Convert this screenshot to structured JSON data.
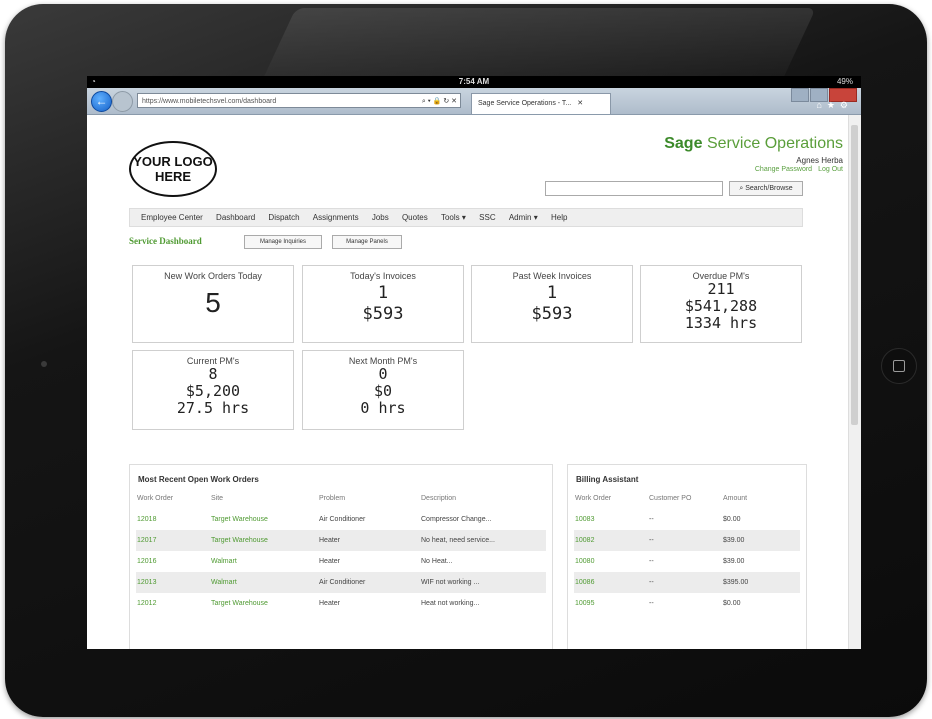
{
  "status": {
    "time": "7:54 AM",
    "battery": "49%"
  },
  "browser": {
    "url": "https://www.mobiletechsvel.com/dashboard",
    "url_controls": "⌕ ▾ 🔒 ↻ ✕",
    "tab_title": "Sage Service Operations - T...",
    "tab_close": "✕"
  },
  "app": {
    "logo": "YOUR LOGO HERE",
    "brand_bold": "Sage",
    "brand_rest": "Service Operations",
    "user_name": "Agnes Herba",
    "change_password": "Change Password",
    "log_out": "Log Out",
    "search_placeholder": "",
    "search_button": "⌕ Search/Browse"
  },
  "menu": [
    "Employee Center",
    "Dashboard",
    "Dispatch",
    "Assignments",
    "Jobs",
    "Quotes",
    "Tools ▾",
    "SSC",
    "Admin ▾",
    "Help"
  ],
  "dashboard": {
    "title": "Service Dashboard",
    "btn_inquiries": "Manage Inquiries",
    "btn_panels": "Manage Panels"
  },
  "cards": {
    "new_wo": {
      "title": "New Work Orders Today",
      "value": "5"
    },
    "today_inv": {
      "title": "Today's Invoices",
      "count": "1",
      "amount": "$593"
    },
    "week_inv": {
      "title": "Past Week Invoices",
      "count": "1",
      "amount": "$593"
    },
    "overdue": {
      "title": "Overdue PM's",
      "count": "211",
      "amount": "$541,288",
      "hours": "1334 hrs"
    },
    "current": {
      "title": "Current PM's",
      "count": "8",
      "amount": "$5,200",
      "hours": "27.5 hrs"
    },
    "next": {
      "title": "Next Month PM's",
      "count": "0",
      "amount": "$0",
      "hours": "0 hrs"
    }
  },
  "work_orders": {
    "title": "Most Recent Open Work Orders",
    "headers": [
      "Work Order",
      "Site",
      "Problem",
      "Description"
    ],
    "rows": [
      [
        "12018",
        "Target Warehouse",
        "Air Conditioner",
        "Compressor Change..."
      ],
      [
        "12017",
        "Target Warehouse",
        "Heater",
        "No heat, need service..."
      ],
      [
        "12016",
        "Walmart",
        "Heater",
        "No Heat..."
      ],
      [
        "12013",
        "Walmart",
        "Air Conditioner",
        "WIF not working ..."
      ],
      [
        "12012",
        "Target Warehouse",
        "Heater",
        "Heat not working..."
      ]
    ]
  },
  "billing": {
    "title": "Billing Assistant",
    "headers": [
      "Work Order",
      "Customer PO",
      "Amount"
    ],
    "rows": [
      [
        "10083",
        "--",
        "$0.00"
      ],
      [
        "10082",
        "--",
        "$39.00"
      ],
      [
        "10080",
        "--",
        "$39.00"
      ],
      [
        "10086",
        "--",
        "$395.00"
      ],
      [
        "10095",
        "--",
        "$0.00"
      ]
    ]
  }
}
